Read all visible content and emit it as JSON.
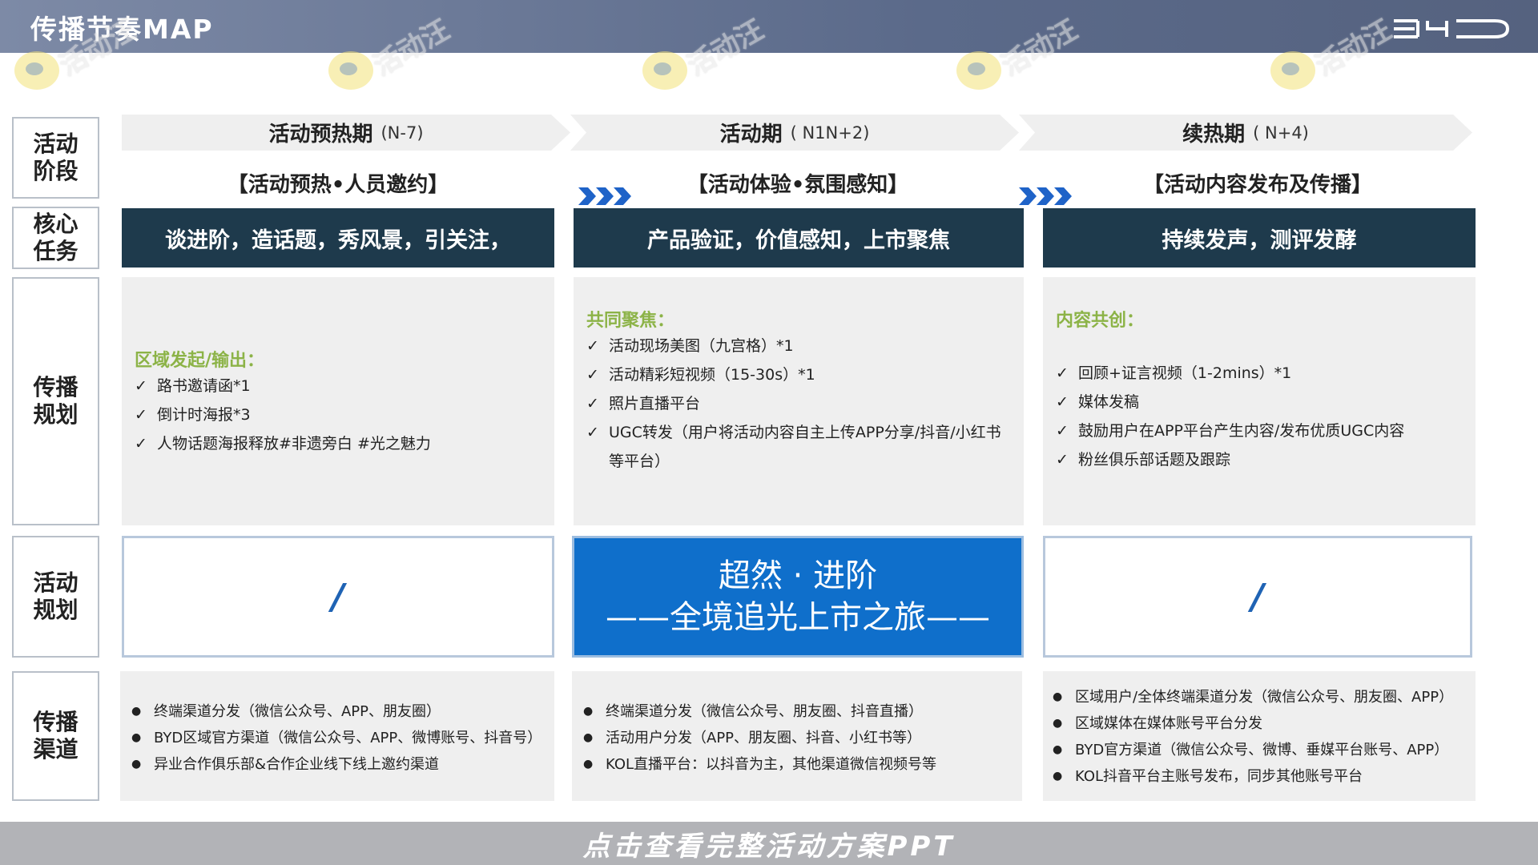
{
  "header": {
    "title": "传播节奏MAP",
    "logo": "BYD"
  },
  "row_labels": {
    "stage": "活动阶段",
    "core": "核心任务",
    "plan": "传播规划",
    "activity": "活动规划",
    "channel": "传播渠道"
  },
  "phases": [
    {
      "name": "活动预热期",
      "code": "(N-7)",
      "theme": "【活动预热•人员邀约】",
      "task": "谈进阶，造话题，秀风景，引关注，",
      "plan_title": "区域发起/输出：",
      "plan_items": [
        "路书邀请函*1",
        "倒计时海报*3",
        "人物话题海报释放#非遗旁白 #光之魅力"
      ],
      "activity": "/",
      "channels": [
        "终端渠道分发（微信公众号、APP、朋友圈）",
        "BYD区域官方渠道（微信公众号、APP、微博账号、抖音号）",
        "异业合作俱乐部&合作企业线下线上邀约渠道"
      ]
    },
    {
      "name": "活动期",
      "code": "( N1N+2)",
      "theme": "【活动体验•氛围感知】",
      "task": "产品验证，价值感知，上市聚焦",
      "plan_title": "共同聚焦：",
      "plan_items": [
        "活动现场美图（九宫格）*1",
        "活动精彩短视频（15-30s）*1",
        "照片直播平台",
        "UGC转发（用户将活动内容自主上传APP分享/抖音/小红书等平台）"
      ],
      "activity_line1": "超然 · 进阶",
      "activity_line2": "——全境追光上市之旅——",
      "channels": [
        "终端渠道分发（微信公众号、朋友圈、抖音直播）",
        "活动用户分发（APP、朋友圈、抖音、小红书等）",
        "KOL直播平台：以抖音为主，其他渠道微信视频号等"
      ]
    },
    {
      "name": "续热期",
      "code": "( N+4)",
      "theme": "【活动内容发布及传播】",
      "task": "持续发声，测评发酵",
      "plan_title": "内容共创：",
      "plan_items": [
        "回顾+证言视频（1-2mins）*1",
        "媒体发稿",
        "鼓励用户在APP平台产生内容/发布优质UGC内容",
        "粉丝俱乐部话题及跟踪"
      ],
      "activity": "/",
      "channels": [
        "区域用户/全体终端渠道分发（微信公众号、朋友圈、APP）",
        "区域媒体在媒体账号平台分发",
        "BYD官方渠道（微信公众号、微博、垂媒平台账号、APP）",
        "KOL抖音平台主账号发布，同步其他账号平台"
      ]
    }
  ],
  "marks": {
    "check": "✓",
    "bullet": "●"
  },
  "watermark": "活动汪",
  "footer": {
    "cta": "点击查看完整活动方案PPT"
  },
  "colors": {
    "header": "#5b6a8a",
    "task_bar": "#1e3a4c",
    "highlight": "#0f6fcb",
    "section_title": "#8cb347",
    "chevron": "#1f63c8"
  }
}
